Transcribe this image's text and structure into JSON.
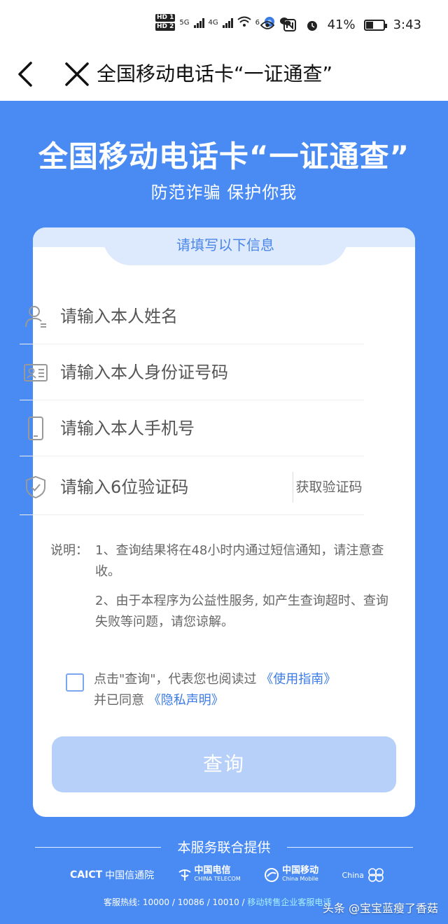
{
  "status_bar": {
    "hd1": "HD 1",
    "hd2": "HD 2",
    "net1": "5G",
    "net2": "4G",
    "wifi_label": "6",
    "battery": "41%",
    "time": "3:43"
  },
  "nav": {
    "title": "全国移动电话卡“一证通查”"
  },
  "hero": {
    "title": "全国移动电话卡“一证通查”",
    "subtitle": "防范诈骗 保护你我"
  },
  "form": {
    "header": "请填写以下信息",
    "name_placeholder": "请输入本人姓名",
    "id_placeholder": "请输入本人身份证号码",
    "phone_placeholder": "请输入本人手机号",
    "code_placeholder": "请输入6位验证码",
    "get_code": "获取验证码"
  },
  "notes": {
    "label": "说明：",
    "item1": "1、查询结果将在48小时内通过短信通知，请注意查收。",
    "item2": "2、由于本程序为公益性服务, 如产生查询超时、查询失败等问题，请您谅解。"
  },
  "agreement": {
    "text1": "点击\"查询\"，代表您也阅读过",
    "link1": "《使用指南》",
    "text2": "并已同意",
    "link2": "《隐私声明》"
  },
  "query_button": "查询",
  "footer": {
    "title": "本服务联合提供",
    "logo_caict": "CAICT",
    "logo_caict_cn": "中国信通院",
    "logo_telecom_cn": "中国电信",
    "logo_telecom_en": "CHINA TELECOM",
    "logo_mobile_cn": "中国移动",
    "logo_mobile_en": "China Mobile",
    "logo_unicom_en": "China",
    "hotline_prefix": "客服热线: 10000 / 10086 / 10010 / ",
    "hotline_link": "移动转售企业客服电话"
  },
  "watermark": "头条 @宝宝蓝瘦了香菇"
}
